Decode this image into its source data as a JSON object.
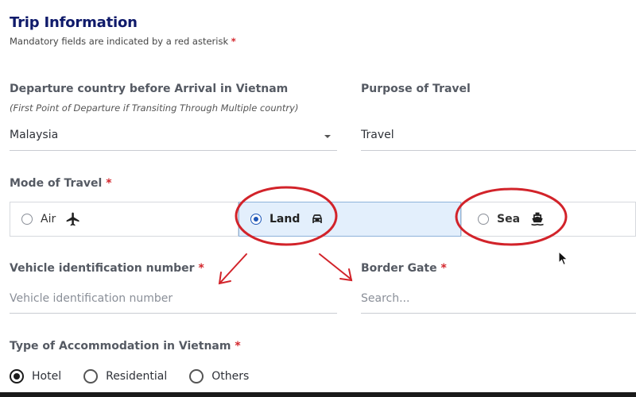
{
  "header": {
    "title": "Trip Information",
    "subtitle": "Mandatory fields are indicated by a red asterisk",
    "asterisk": "*"
  },
  "departure": {
    "label": "Departure country before Arrival in Vietnam",
    "hint": "(First Point of Departure if Transiting Through Multiple country)",
    "value": "Malaysia"
  },
  "purpose": {
    "label": "Purpose of Travel",
    "value": "Travel"
  },
  "mode": {
    "label": "Mode of Travel",
    "asterisk": "*",
    "options": [
      {
        "label": "Air",
        "icon": "airplane-icon",
        "selected": false
      },
      {
        "label": "Land",
        "icon": "car-icon",
        "selected": true
      },
      {
        "label": "Sea",
        "icon": "ship-icon",
        "selected": false
      }
    ]
  },
  "vehicle": {
    "label": "Vehicle identification number",
    "asterisk": "*",
    "placeholder": "Vehicle identification number"
  },
  "border": {
    "label": "Border Gate",
    "asterisk": "*",
    "placeholder": "Search..."
  },
  "accommodation": {
    "label": "Type of Accommodation in Vietnam",
    "asterisk": "*",
    "options": [
      {
        "label": "Hotel",
        "selected": true
      },
      {
        "label": "Residential",
        "selected": false
      },
      {
        "label": "Others",
        "selected": false
      }
    ]
  },
  "colors": {
    "title": "#0f1a6a",
    "required": "#d3262c",
    "selected_bg": "#e3effc",
    "annotation": "#d2232a"
  }
}
